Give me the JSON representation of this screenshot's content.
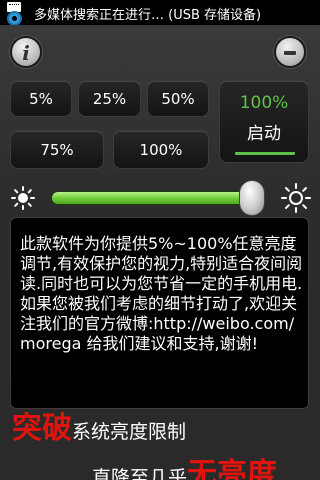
{
  "status_bar": {
    "notification_text": "多媒体搜索正在进行… (USB 存储设备)",
    "icons": [
      "sd-card-icon",
      "settings-icon"
    ]
  },
  "header": {
    "info_label": "i",
    "icons": [
      "info-icon",
      "minus-icon"
    ]
  },
  "presets": [
    "5%",
    "25%",
    "50%",
    "75%",
    "100%"
  ],
  "start": {
    "value": "100%",
    "label": "启动"
  },
  "slider": {
    "level_fraction": 1.0,
    "icons": [
      "brightness-low-icon",
      "brightness-high-icon"
    ]
  },
  "description": "此款软件为你提供5%~100%任意亮度调节,有效保护您的视力,特别适合夜间阅读.同时也可以为您节省一定的手机用电.如果您被我们考虑的细节打动了,欢迎关注我们的官方微博:http://weibo.com/morega 给我们建议和支持,谢谢!",
  "promo": {
    "line1_big": "突破",
    "line1_rest": "系统亮度限制",
    "line2_rest": "直降至几乎",
    "line2_big": "无亮度"
  },
  "colors": {
    "accent_green": "#5ec24a",
    "promo_red": "#e0140e"
  }
}
